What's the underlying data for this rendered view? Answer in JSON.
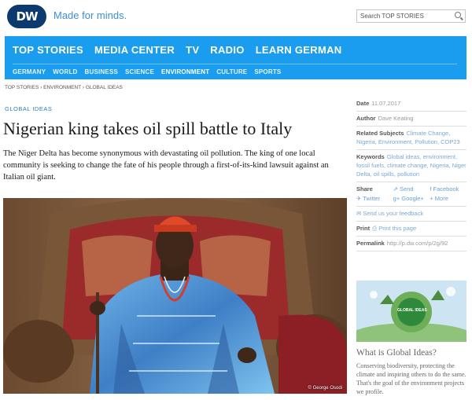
{
  "header": {
    "logo": "DW",
    "tagline": "Made for minds.",
    "search_placeholder": "Search TOP STORIES"
  },
  "nav": {
    "main": [
      "TOP STORIES",
      "MEDIA CENTER",
      "TV",
      "RADIO",
      "LEARN GERMAN"
    ],
    "sub": [
      "GERMANY",
      "WORLD",
      "BUSINESS",
      "SCIENCE",
      "ENVIRONMENT",
      "CULTURE",
      "SPORTS"
    ],
    "active_sub": "ENVIRONMENT"
  },
  "breadcrumb": "TOP STORIES › ENVIRONMENT › GLOBAL IDEAS",
  "article": {
    "kicker": "GLOBAL IDEAS",
    "headline": "Nigerian king takes oil spill battle to Italy",
    "lead": "The Niger Delta has become synonymous with devastating oil pollution. The king of one local community is seeking to change the fate of his people through a first-of-its-kind lawsuit against an Italian oil giant.",
    "photo_credit": "© George Osodi"
  },
  "sidebar": {
    "date_label": "Date",
    "date": "11.07.2017",
    "author_label": "Author",
    "author": "Dave Keating",
    "related_label": "Related Subjects",
    "related": "Climate Change, Nigeria, Environment, Pollution, COP23",
    "keywords_label": "Keywords",
    "keywords": "Global ideas, environment, fossil fuels, climate change, Nigeria, Niger Delta, oil spills, pollution",
    "share_label": "Share",
    "share_send": "Send",
    "share_facebook": "Facebook",
    "share_twitter": "Twitter",
    "share_google": "Google+",
    "share_more": "More",
    "feedback": "Send us your feedback",
    "print_label": "Print",
    "print_page": "Print this page",
    "permalink_label": "Permalink",
    "permalink": "http://p.dw.com/p/2g/92",
    "promo_badge": "GLOBAL IDEAS",
    "promo_title": "What is Global Ideas?",
    "promo_text": "Conserving biodiversity, protecting the climate and inspiring others to do the same. That's the goal of the environment projects we profile."
  },
  "colors": {
    "nav": "#1a9dee",
    "logo": "#0c3a6e",
    "link": "#3b8fd6"
  }
}
